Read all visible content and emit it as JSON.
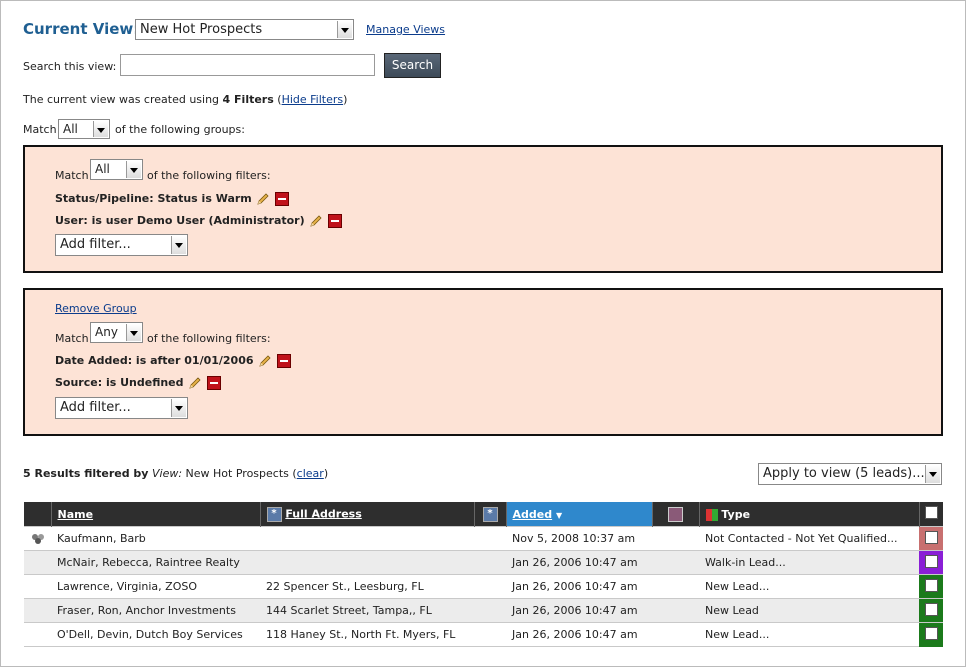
{
  "view": {
    "label": "Current View:",
    "selected": "New Hot Prospects",
    "manage_link": "Manage Views"
  },
  "search": {
    "label": "Search this view:",
    "value": "",
    "button": "Search"
  },
  "filters_info": {
    "prefix": "The current view was created using",
    "count_text": "4 Filters",
    "open_paren": "(",
    "hide_link": "Hide Filters",
    "close_paren": ")"
  },
  "match_groups": {
    "label": "Match",
    "value": "All",
    "suffix": "of the following groups:"
  },
  "groups": [
    {
      "match_label": "Match",
      "match_value": "All",
      "match_suffix": "of the following filters:",
      "filters": [
        "Status/Pipeline: Status is Warm",
        "User: is user Demo User (Administrator)"
      ],
      "add_filter": "Add filter..."
    },
    {
      "remove_link": "Remove Group",
      "match_label": "Match",
      "match_value": "Any",
      "match_suffix": "of the following filters:",
      "filters": [
        "Date Added: is after 01/01/2006",
        "Source: is Undefined"
      ],
      "add_filter": "Add filter..."
    }
  ],
  "results": {
    "count_text": "5 Results filtered by",
    "view_label": "View:",
    "view_name": "New Hot Prospects",
    "open_paren": "(",
    "clear_link": "clear",
    "close_paren": ")",
    "apply_select": "Apply to view (5 leads)..."
  },
  "table": {
    "columns": {
      "name": "Name",
      "address": "Full Address",
      "added": "Added",
      "type": "Type"
    },
    "rows": [
      {
        "name": "Kaufmann, Barb",
        "address": "",
        "added": "Nov 5, 2008 10:37 am",
        "type": "Not Contacted - Not Yet Qualified...",
        "color": "#c87070"
      },
      {
        "name": "McNair, Rebecca, Raintree Realty",
        "address": "",
        "added": "Jan 26, 2006 10:47 am",
        "type": "Walk-in Lead...",
        "color": "#8a1fd6"
      },
      {
        "name": "Lawrence, Virginia, ZOSO",
        "address": "22 Spencer St., Leesburg, FL",
        "added": "Jan 26, 2006 10:47 am",
        "type": "New Lead...",
        "color": "#1b7a1b"
      },
      {
        "name": "Fraser, Ron, Anchor Investments",
        "address": "144 Scarlet Street, Tampa,, FL",
        "added": "Jan 26, 2006 10:47 am",
        "type": "New Lead",
        "color": "#1b7a1b"
      },
      {
        "name": "O'Dell, Devin, Dutch Boy Services",
        "address": "118 Haney St., North Ft. Myers, FL",
        "added": "Jan 26, 2006 10:47 am",
        "type": "New Lead...",
        "color": "#1b7a1b"
      }
    ]
  },
  "colors": {
    "group_bg": "#fde3d6",
    "header_bg": "#2e2e2e",
    "sorted_header_bg": "#2f88cc",
    "title_blue": "#1f5f92"
  }
}
